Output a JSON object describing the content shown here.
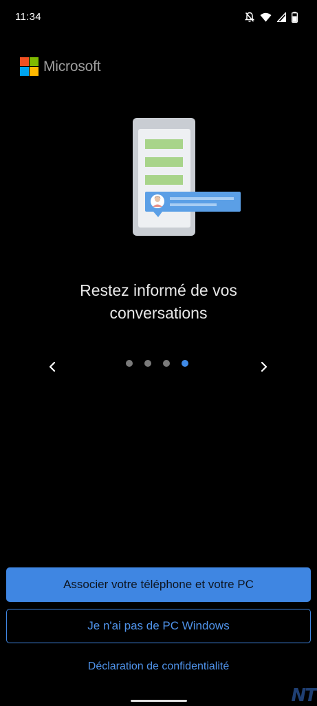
{
  "status_bar": {
    "time": "11:34",
    "icons": [
      "notifications-off-icon",
      "wifi-icon",
      "signal-icon",
      "battery-icon"
    ]
  },
  "brand": {
    "name": "Microsoft",
    "colors": [
      "#f25022",
      "#7fba00",
      "#00a4ef",
      "#ffb900"
    ]
  },
  "onboarding": {
    "headline": "Restez informé de vos conversations",
    "page_count": 4,
    "active_page": 4,
    "prev_icon": "chevron-left-icon",
    "next_icon": "chevron-right-icon"
  },
  "actions": {
    "primary_label": "Associer votre téléphone et votre PC",
    "secondary_label": "Je n'ai pas de PC Windows",
    "privacy_label": "Déclaration de confidentialité"
  },
  "watermark": "NT",
  "colors": {
    "accent": "#3f86e2",
    "background": "#000000",
    "dot_inactive": "#7a7a7a",
    "dot_active": "#3f8ae6"
  }
}
